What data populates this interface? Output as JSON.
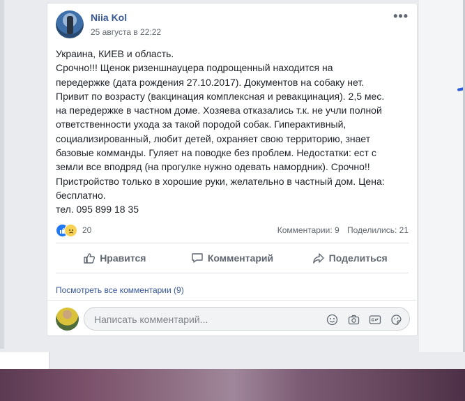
{
  "post": {
    "author": "Niia Kol",
    "time": "25 августа в 22:22",
    "more_label": "•••",
    "text_lines": [
      "Украина, КИЕВ и область.",
      "Срочно!!! Щенок ризеншнауцера подрощенный находится на",
      "передержке (дата рождения 27.10.2017). Документов на собаку нет.",
      "Привит по возрасту (вакцинация комплексная и ревакцинация). 2,5 мес.",
      "на передержке в частном доме. Хозяева отказались т.к. не учли полной",
      "ответственности ухода за такой породой собак. Гиперактивный,",
      "социализированный, любит детей, охраняет свою территорию, знает",
      "базовые комманды. Гуляет на поводке без проблем. Недостатки: ест с",
      "земли все вподряд (на прогулке нужно одевать намордник). Срочно!!",
      "Пристройство только в хорошие руки, желательно в частный дом. Цена:",
      "бесплатно.",
      "тел. 095 899 18 35"
    ]
  },
  "reactions": {
    "count": "20",
    "icons": [
      "like-icon",
      "sad-icon"
    ],
    "comments_stat": "Комментарии: 9",
    "shares_stat": "Поделились: 21"
  },
  "actions": {
    "like": "Нравится",
    "comment": "Комментарий",
    "share": "Поделиться"
  },
  "comments": {
    "view_all": "Посмотреть все комментарии (9)",
    "input_placeholder": "Написать комментарий...",
    "input_value": "",
    "buttons": [
      "emoji-icon",
      "camera-icon",
      "gif-icon",
      "sticker-icon"
    ]
  },
  "colors": {
    "link_blue": "#385898",
    "text": "#1d2129",
    "muted": "#606770",
    "like_blue": "#2078f4"
  }
}
